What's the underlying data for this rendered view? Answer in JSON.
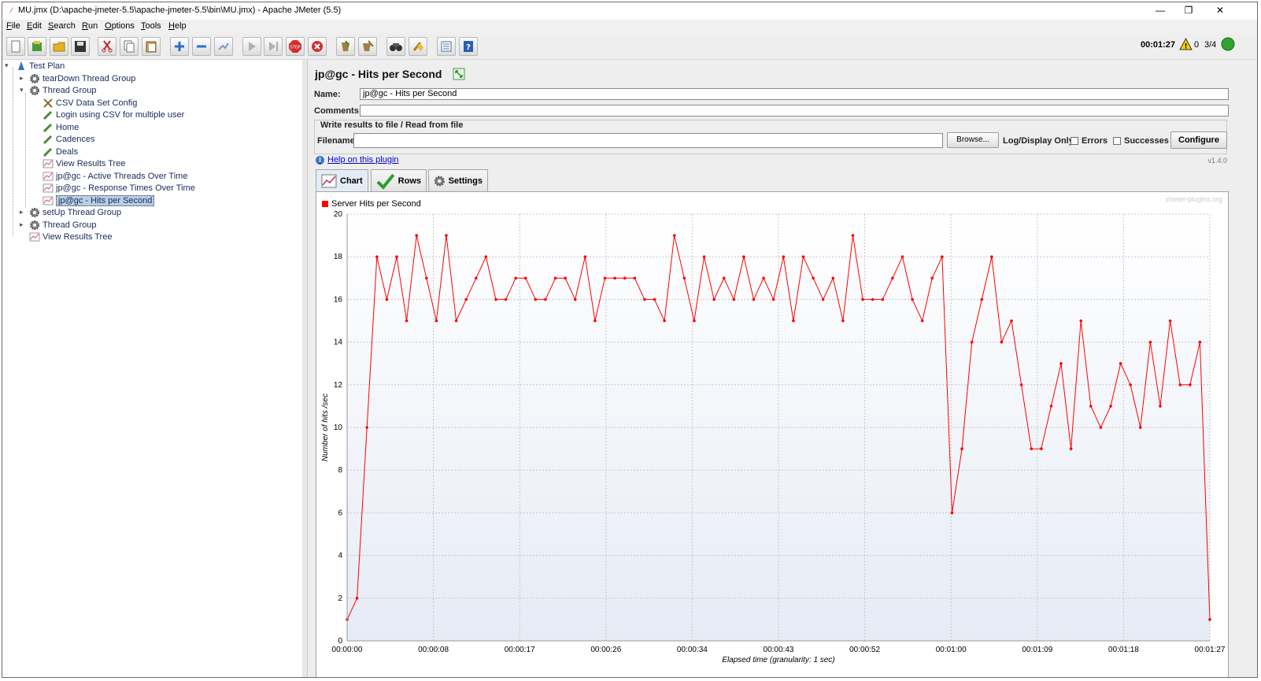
{
  "window": {
    "title": "MU.jmx (D:\\apache-jmeter-5.5\\apache-jmeter-5.5\\bin\\MU.jmx) - Apache JMeter (5.5)",
    "minimize": "—",
    "restore": "❐",
    "close": "✕"
  },
  "menu": [
    "File",
    "Edit",
    "Search",
    "Run",
    "Options",
    "Tools",
    "Help"
  ],
  "status": {
    "elapsed": "00:01:27",
    "warnings": "0",
    "threads": "3/4"
  },
  "tree": [
    {
      "label": "Test Plan",
      "icon": "test-plan-icon"
    },
    {
      "label": "tearDown Thread Group",
      "icon": "gear-icon"
    },
    {
      "label": "Thread Group",
      "icon": "gear-icon"
    },
    {
      "label": "CSV Data Set Config",
      "icon": "tools-icon"
    },
    {
      "label": "Login using CSV for multiple user",
      "icon": "pipette-icon"
    },
    {
      "label": "Home",
      "icon": "pipette-icon"
    },
    {
      "label": "Cadences",
      "icon": "pipette-icon"
    },
    {
      "label": "Deals",
      "icon": "pipette-icon"
    },
    {
      "label": "View Results Tree",
      "icon": "graph-icon"
    },
    {
      "label": "jp@gc - Active Threads Over Time",
      "icon": "graph-icon"
    },
    {
      "label": "jp@gc - Response Times Over Time",
      "icon": "graph-icon"
    },
    {
      "label": "jp@gc - Hits per Second",
      "icon": "graph-icon"
    },
    {
      "label": "setUp Thread Group",
      "icon": "gear-icon"
    },
    {
      "label": "Thread Group",
      "icon": "gear-icon"
    },
    {
      "label": "View Results Tree",
      "icon": "graph-icon"
    }
  ],
  "panel": {
    "title": "jp@gc - Hits per Second",
    "name_label": "Name:",
    "name_value": "jp@gc - Hits per Second",
    "comments_label": "Comments:",
    "comments_value": "",
    "group_title": "Write results to file / Read from file",
    "filename_label": "Filename",
    "filename_value": "",
    "browse": "Browse...",
    "log_display_only": "Log/Display Only:",
    "errors": "Errors",
    "successes": "Successes",
    "configure": "Configure",
    "help_link": "Help on this plugin",
    "version": "v1.4.0",
    "tabs": [
      "Chart",
      "Rows",
      "Settings"
    ]
  },
  "chart_data": {
    "type": "line",
    "series": [
      {
        "name": "Server Hits per Second",
        "color": "#ff0000",
        "values": [
          1,
          2,
          10,
          18,
          16,
          18,
          15,
          19,
          17,
          15,
          19,
          15,
          16,
          17,
          18,
          16,
          16,
          17,
          17,
          16,
          16,
          17,
          17,
          16,
          18,
          15,
          17,
          17,
          17,
          17,
          16,
          16,
          15,
          19,
          17,
          15,
          18,
          16,
          17,
          16,
          18,
          16,
          17,
          16,
          18,
          15,
          18,
          17,
          16,
          17,
          15,
          19,
          16,
          16,
          16,
          17,
          18,
          16,
          15,
          17,
          18,
          6,
          9,
          14,
          16,
          18,
          14,
          15,
          12,
          9,
          9,
          11,
          13,
          9,
          15,
          11,
          10,
          11,
          13,
          12,
          10,
          14,
          11,
          15,
          12,
          12,
          14,
          1
        ]
      }
    ],
    "x_tick_labels": [
      "00:00:00",
      "00:00:08",
      "00:00:17",
      "00:00:26",
      "00:00:34",
      "00:00:43",
      "00:00:52",
      "00:01:00",
      "00:01:09",
      "00:01:18",
      "00:01:27"
    ],
    "y_ticks": [
      0,
      2,
      4,
      6,
      8,
      10,
      12,
      14,
      16,
      18,
      20
    ],
    "ylim": [
      0,
      20
    ],
    "xlabel": "Elapsed time (granularity: 1 sec)",
    "ylabel": "Number of hits /sec",
    "watermark": "jmeter-plugins.org",
    "grid": true,
    "legend": "top-left"
  }
}
